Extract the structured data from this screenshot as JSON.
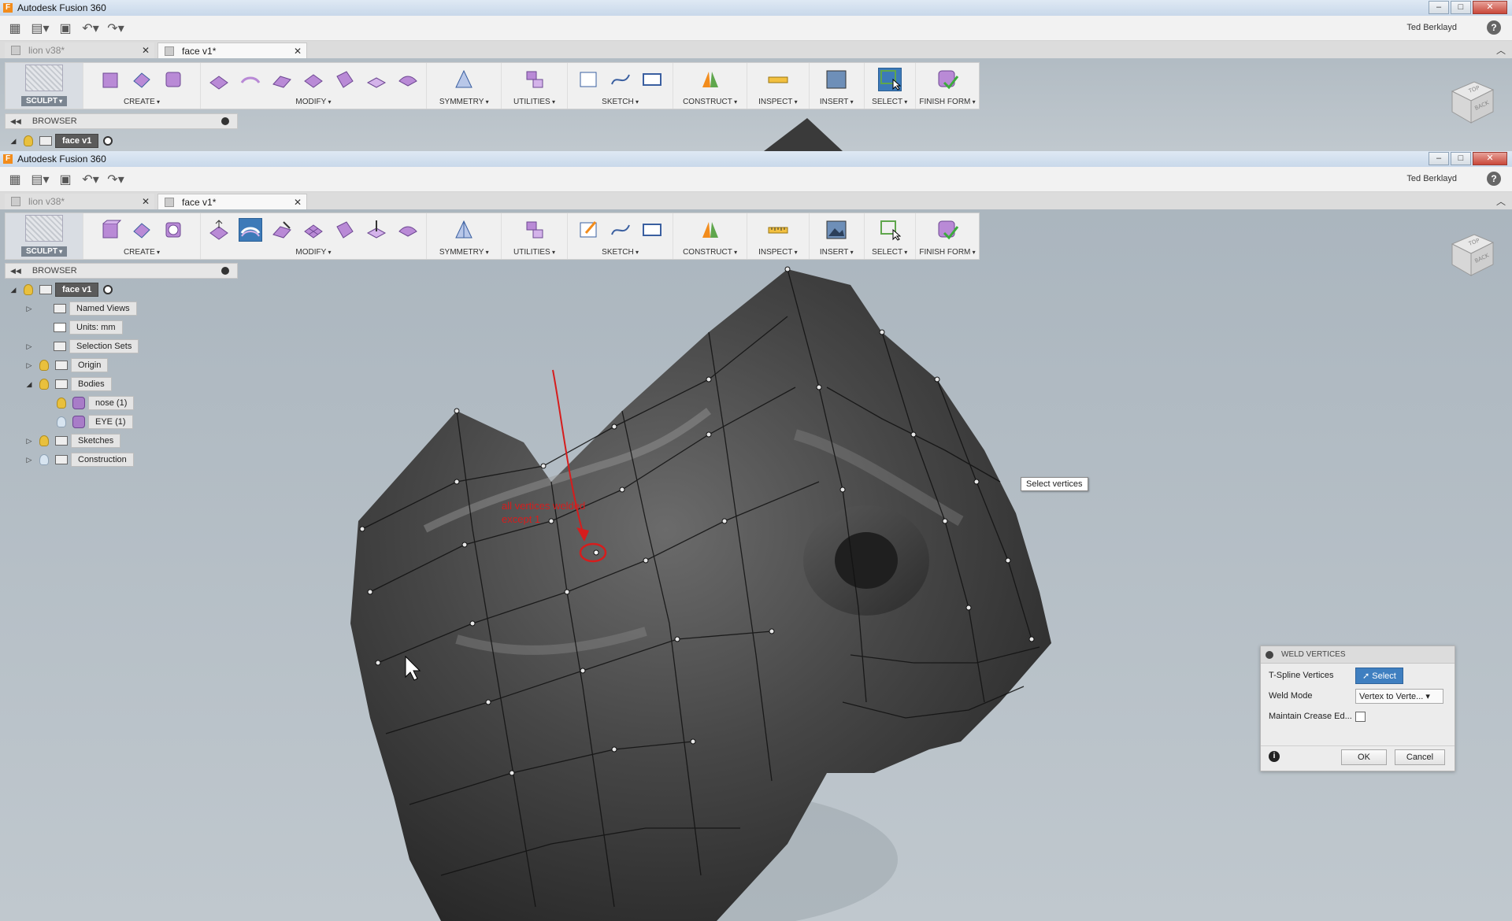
{
  "app": {
    "title": "Autodesk Fusion 360",
    "user": "Ted Berklayd"
  },
  "tabs": [
    {
      "label": "lion v38*"
    },
    {
      "label": "face v1*"
    }
  ],
  "toolbar": {
    "sculpt": "SCULPT",
    "create": "CREATE",
    "modify": "MODIFY",
    "symmetry": "SYMMETRY",
    "utilities": "UTILITIES",
    "sketch": "SKETCH",
    "construct": "CONSTRUCT",
    "inspect": "INSPECT",
    "insert": "INSERT",
    "select": "SELECT",
    "finish_form": "FINISH FORM"
  },
  "browser": {
    "header": "BROWSER",
    "root": "face v1",
    "items": [
      {
        "label": "Named Views"
      },
      {
        "label": "Units: mm"
      },
      {
        "label": "Selection Sets"
      },
      {
        "label": "Origin"
      },
      {
        "label": "Bodies"
      },
      {
        "label": "nose (1)"
      },
      {
        "label": "EYE (1)"
      },
      {
        "label": "Sketches"
      },
      {
        "label": "Construction"
      }
    ]
  },
  "viewcube": {
    "face_top": "TOP",
    "face_back": "BACK"
  },
  "annotation": {
    "line1": "all vertices welded",
    "line2": "except 1"
  },
  "tooltip": "Select vertices",
  "dialog": {
    "title": "WELD VERTICES",
    "tspline_label": "T-Spline Vertices",
    "select_btn": "Select",
    "weld_mode_label": "Weld Mode",
    "weld_mode_value": "Vertex to Verte...",
    "crease_label": "Maintain Crease Ed...",
    "ok": "OK",
    "cancel": "Cancel"
  },
  "colors": {
    "selection_blue": "#3d7ab8",
    "annotation_red": "#d61d1d",
    "sculpt_purple": "#a87cc8"
  }
}
